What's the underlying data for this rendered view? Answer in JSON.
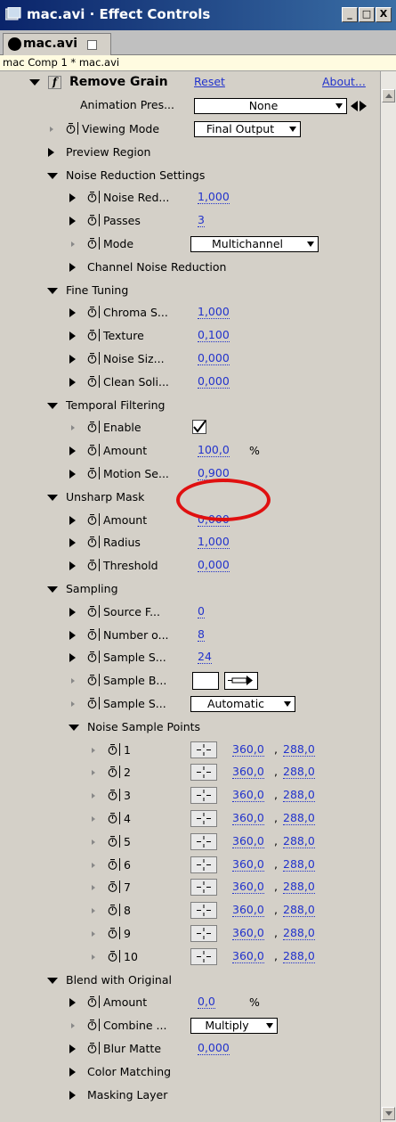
{
  "window": {
    "title": "mac.avi · Effect Controls",
    "minimize": "_",
    "maximize": "□",
    "close": "X"
  },
  "tab": {
    "label": "mac.avi"
  },
  "comp_label": "mac Comp 1 * mac.avi",
  "effect": {
    "name": "Remove Grain",
    "reset": "Reset",
    "about": "About..."
  },
  "animation_presets": {
    "label": "Animation Pres...",
    "value": "None"
  },
  "rows": [
    {
      "label": "Viewing Mode",
      "value": "Final Output"
    },
    {
      "label": "Preview Region"
    },
    {
      "label": "Noise Reduction Settings"
    },
    {
      "label": "Noise Red...",
      "value": "1,000"
    },
    {
      "label": "Passes",
      "value": "3"
    },
    {
      "label": "Mode",
      "value": "Multichannel"
    },
    {
      "label": "Channel Noise Reduction"
    },
    {
      "label": "Fine Tuning"
    },
    {
      "label": "Chroma S...",
      "value": "1,000"
    },
    {
      "label": "Texture",
      "value": "0,100"
    },
    {
      "label": "Noise Siz...",
      "value": "0,000"
    },
    {
      "label": "Clean Soli...",
      "value": "0,000"
    },
    {
      "label": "Temporal Filtering"
    },
    {
      "label": "Enable",
      "checked": true
    },
    {
      "label": "Amount",
      "value": "100,0",
      "unit": "%"
    },
    {
      "label": "Motion Se...",
      "value": "0,900"
    },
    {
      "label": "Unsharp Mask"
    },
    {
      "label": "Amount",
      "value": "0,000"
    },
    {
      "label": "Radius",
      "value": "1,000"
    },
    {
      "label": "Threshold",
      "value": "0,000"
    },
    {
      "label": "Sampling"
    },
    {
      "label": "Source F...",
      "value": "0"
    },
    {
      "label": "Number o...",
      "value": "8"
    },
    {
      "label": "Sample S...",
      "value": "24"
    },
    {
      "label": "Sample B..."
    },
    {
      "label": "Sample S...",
      "value": "Automatic"
    },
    {
      "label": "Noise Sample Points"
    },
    {
      "label": "1",
      "x": "360,0",
      "y": "288,0"
    },
    {
      "label": "2",
      "x": "360,0",
      "y": "288,0"
    },
    {
      "label": "3",
      "x": "360,0",
      "y": "288,0"
    },
    {
      "label": "4",
      "x": "360,0",
      "y": "288,0"
    },
    {
      "label": "5",
      "x": "360,0",
      "y": "288,0"
    },
    {
      "label": "6",
      "x": "360,0",
      "y": "288,0"
    },
    {
      "label": "7",
      "x": "360,0",
      "y": "288,0"
    },
    {
      "label": "8",
      "x": "360,0",
      "y": "288,0"
    },
    {
      "label": "9",
      "x": "360,0",
      "y": "288,0"
    },
    {
      "label": "10",
      "x": "360,0",
      "y": "288,0"
    },
    {
      "label": "Blend with Original"
    },
    {
      "label": "Amount",
      "value": "0,0",
      "unit": "%"
    },
    {
      "label": "Combine ...",
      "value": "Multiply"
    },
    {
      "label": "Blur Matte",
      "value": "0,000"
    },
    {
      "label": "Color Matching"
    },
    {
      "label": "Masking Layer"
    }
  ],
  "point_separator": ","
}
